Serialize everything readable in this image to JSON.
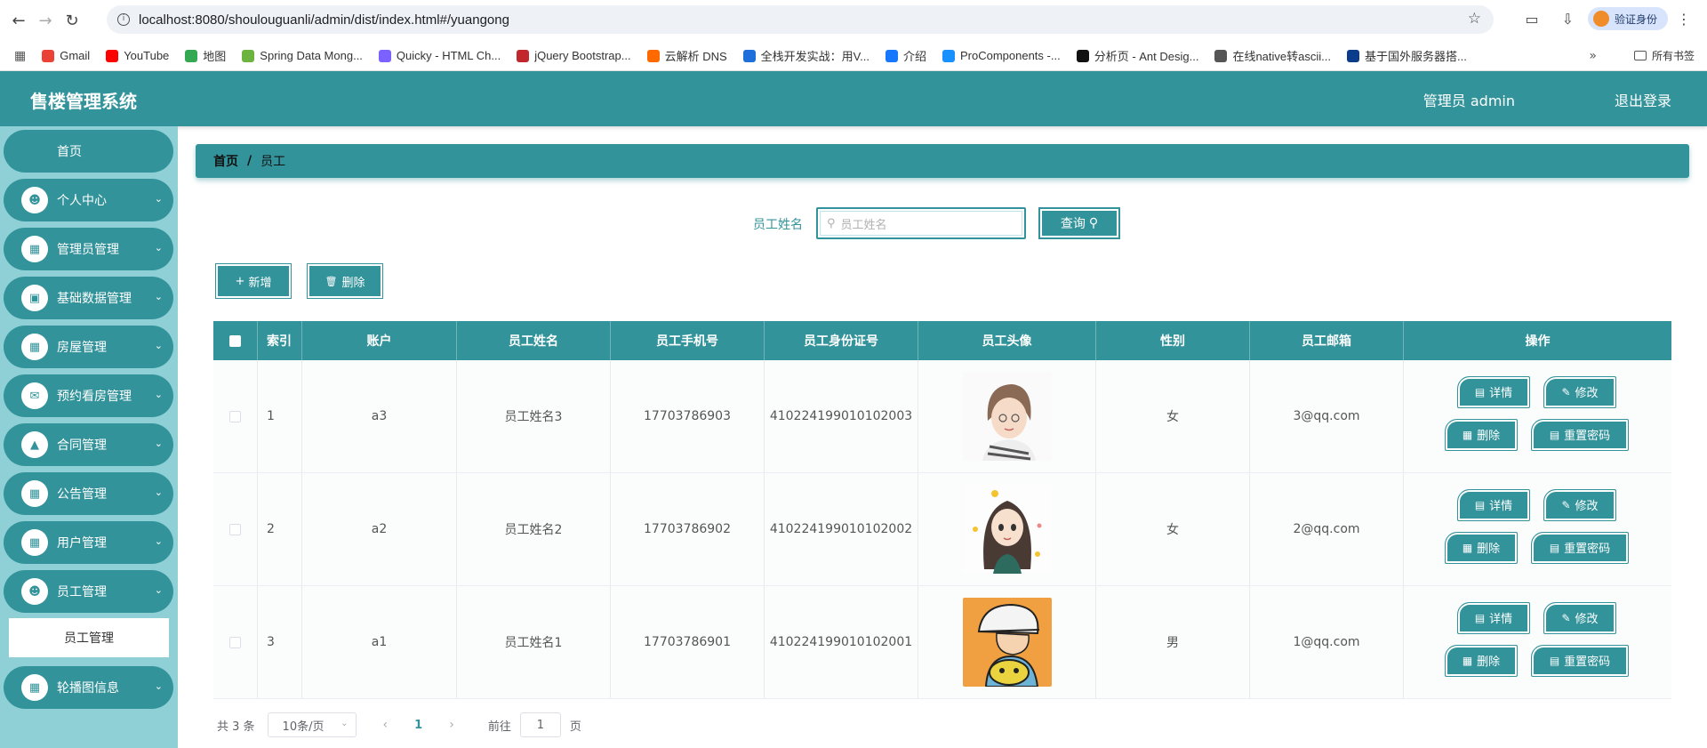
{
  "browser": {
    "url": "localhost:8080/shoulouguanli/admin/dist/index.html#/yuangong",
    "verify_label": "验证身份",
    "all_bookmarks": "所有书签",
    "bookmarks": [
      {
        "label": "Gmail",
        "color": "#ea4335"
      },
      {
        "label": "YouTube",
        "color": "#ff0000"
      },
      {
        "label": "地图",
        "color": "#34a853"
      },
      {
        "label": "Spring Data Mong...",
        "color": "#6db33f"
      },
      {
        "label": "Quicky - HTML Ch...",
        "color": "#7b61ff"
      },
      {
        "label": "jQuery Bootstrap...",
        "color": "#c1272d"
      },
      {
        "label": "云解析 DNS",
        "color": "#ff6a00"
      },
      {
        "label": "全栈开发实战：用V...",
        "color": "#1e6fd9"
      },
      {
        "label": "介绍",
        "color": "#1677ff"
      },
      {
        "label": "ProComponents -...",
        "color": "#1890ff"
      },
      {
        "label": "分析页 - Ant Desig...",
        "color": "#111111"
      },
      {
        "label": "在线native转ascii...",
        "color": "#555555"
      },
      {
        "label": "基于国外服务器搭...",
        "color": "#0b3c8c"
      }
    ]
  },
  "header": {
    "title": "售楼管理系统",
    "admin": "管理员 admin",
    "logout": "退出登录"
  },
  "sidebar": {
    "home": "首页",
    "items": [
      {
        "label": "个人中心",
        "icon": "user-icon"
      },
      {
        "label": "管理员管理",
        "icon": "grid-icon"
      },
      {
        "label": "基础数据管理",
        "icon": "wallet-icon"
      },
      {
        "label": "房屋管理",
        "icon": "grid-icon"
      },
      {
        "label": "预约看房管理",
        "icon": "chat-icon"
      },
      {
        "label": "合同管理",
        "icon": "stamp-icon"
      },
      {
        "label": "公告管理",
        "icon": "grid-icon"
      },
      {
        "label": "用户管理",
        "icon": "grid-icon"
      },
      {
        "label": "员工管理",
        "icon": "user-icon"
      }
    ],
    "sub_item": "员工管理",
    "last_item": {
      "label": "轮播图信息",
      "icon": "grid-icon"
    }
  },
  "breadcrumb": {
    "home": "首页",
    "separator": "/",
    "current": "员工"
  },
  "search": {
    "label": "员工姓名",
    "placeholder": "员工姓名",
    "button": "查询"
  },
  "toolbar": {
    "add": "新增",
    "delete": "删除"
  },
  "table": {
    "columns": [
      "索引",
      "账户",
      "员工姓名",
      "员工手机号",
      "员工身份证号",
      "员工头像",
      "性别",
      "员工邮箱",
      "操作"
    ],
    "rows": [
      {
        "index": "1",
        "account": "a3",
        "name": "员工姓名3",
        "phone": "17703786903",
        "id_card": "410224199010102003",
        "gender": "女",
        "email": "3@qq.com",
        "avatar": "girl-short-hair-avatar"
      },
      {
        "index": "2",
        "account": "a2",
        "name": "员工姓名2",
        "phone": "17703786902",
        "id_card": "410224199010102002",
        "gender": "女",
        "email": "2@qq.com",
        "avatar": "girl-long-hair-avatar"
      },
      {
        "index": "3",
        "account": "a1",
        "name": "员工姓名1",
        "phone": "17703786901",
        "id_card": "410224199010102001",
        "gender": "男",
        "email": "1@qq.com",
        "avatar": "cartoon-boy-avatar"
      }
    ],
    "ops": {
      "detail": "详情",
      "edit": "修改",
      "delete": "删除",
      "reset": "重置密码"
    }
  },
  "pagination": {
    "total": "共 3 条",
    "page_size": "10条/页",
    "current": "1",
    "goto": "前往",
    "goto_value": "1",
    "page_unit": "页"
  },
  "colors": {
    "primary": "#33939a",
    "sidebar_bg": "#8fd0d6"
  }
}
